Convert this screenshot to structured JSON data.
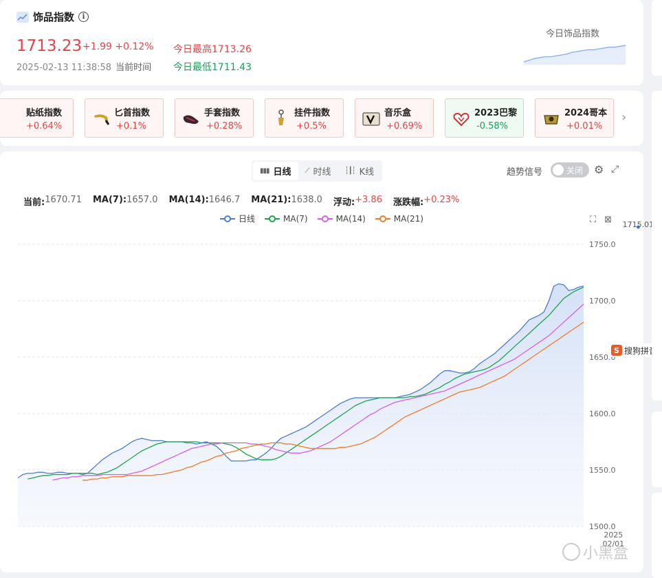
{
  "header": {
    "title": "饰品指数",
    "info_icon": "i",
    "price": "1713.23",
    "change": "+1.99",
    "change_pct": "+0.12%",
    "timestamp": "2025-02-13 11:38:58",
    "timestamp_label": "当前时间",
    "today_high": "今日最高1713.26",
    "today_low": "今日最低1711.43",
    "mini_chart_label": "今日饰品指数",
    "colors": {
      "up": "#e84343",
      "down": "#1aa05a"
    }
  },
  "categories": {
    "prev_icon": "chevron-left-icon",
    "next_icon": "chevron-right-icon",
    "items": [
      {
        "name": "贴纸指数",
        "pct": "+0.64%",
        "trend": "up",
        "icon": "sticker-icon"
      },
      {
        "name": "匕首指数",
        "pct": "+0.1%",
        "trend": "up",
        "icon": "knife-icon"
      },
      {
        "name": "手套指数",
        "pct": "+0.28%",
        "trend": "up",
        "icon": "glove-icon"
      },
      {
        "name": "挂件指数",
        "pct": "+0.5%",
        "trend": "up",
        "icon": "charm-icon"
      },
      {
        "name": "音乐盒",
        "pct": "+0.69%",
        "trend": "up",
        "icon": "music-kit-icon"
      },
      {
        "name": "2023巴黎",
        "pct": "-0.58%",
        "trend": "down",
        "icon": "paris-2023-icon"
      },
      {
        "name": "2024哥本",
        "pct": "+0.01%",
        "trend": "up",
        "icon": "copenhagen-2024-icon"
      }
    ]
  },
  "chart_panel": {
    "tabs": [
      {
        "label": "日线",
        "active": true,
        "icon": "bar-chart-icon"
      },
      {
        "label": "时线",
        "active": false,
        "icon": "line-chart-icon"
      },
      {
        "label": "K线",
        "active": false,
        "icon": "candlestick-icon"
      }
    ],
    "trend_signal_label": "趋势信号",
    "toggle_label": "关闭",
    "stats": {
      "current_label": "当前:",
      "current": "1670.71",
      "ma7_label": "MA(7):",
      "ma7": "1657.0",
      "ma14_label": "MA(14):",
      "ma14": "1646.7",
      "ma21_label": "MA(21):",
      "ma21": "1638.0",
      "float_label": "浮动:",
      "float": "+3.86",
      "pct_label": "涨跌幅:",
      "pct": "+0.23%"
    },
    "ime_text": "搜狗拼音输",
    "ime_logo": "S",
    "watermark": "小黑盒"
  },
  "chart_data": {
    "type": "line",
    "ylim": [
      1500,
      1750
    ],
    "yticks": [
      "1750.0",
      "1700.0",
      "1650.0",
      "1600.0",
      "1550.0",
      "1500.0"
    ],
    "x_tick_label": [
      "2025",
      "02/01"
    ],
    "x_tick_index": 120,
    "legend_position": "top-center",
    "grid": true,
    "peak_label": "1715.01",
    "peak_index": 125,
    "series": [
      {
        "name": "日线",
        "color": "#4a7cd4",
        "area": true,
        "values": [
          1543,
          1546,
          1547,
          1547,
          1548,
          1548,
          1547,
          1547,
          1548,
          1548,
          1547,
          1547,
          1547,
          1546,
          1547,
          1551,
          1555,
          1559,
          1562,
          1565,
          1567,
          1569,
          1572,
          1575,
          1577,
          1578,
          1577,
          1576,
          1576,
          1576,
          1575,
          1575,
          1575,
          1575,
          1574,
          1574,
          1573,
          1574,
          1575,
          1573,
          1571,
          1567,
          1562,
          1558,
          1558,
          1558,
          1558,
          1559,
          1559,
          1562,
          1565,
          1569,
          1574,
          1578,
          1580,
          1582,
          1584,
          1586,
          1588,
          1591,
          1594,
          1597,
          1600,
          1603,
          1606,
          1609,
          1611,
          1613,
          1614,
          1614,
          1614,
          1614,
          1614,
          1614,
          1614,
          1614,
          1614,
          1615,
          1616,
          1617,
          1619,
          1621,
          1624,
          1627,
          1631,
          1635,
          1638,
          1638,
          1637,
          1636,
          1636,
          1637,
          1640,
          1644,
          1647,
          1650,
          1653,
          1657,
          1661,
          1665,
          1669,
          1673,
          1678,
          1683,
          1685,
          1687,
          1690,
          1700,
          1713,
          1715,
          1714,
          1709,
          1710,
          1712,
          1713
        ]
      },
      {
        "name": "MA(7)",
        "color": "#1aa54a",
        "values": [
          1542,
          1543,
          1544,
          1545,
          1545,
          1546,
          1546,
          1546,
          1546,
          1547,
          1547,
          1547,
          1547,
          1547,
          1546,
          1547,
          1548,
          1550,
          1552,
          1555,
          1558,
          1561,
          1564,
          1567,
          1569,
          1571,
          1573,
          1574,
          1575,
          1575,
          1575,
          1575,
          1575,
          1575,
          1575,
          1574,
          1574,
          1574,
          1574,
          1574,
          1573,
          1572,
          1570,
          1567,
          1564,
          1562,
          1560,
          1559,
          1559,
          1559,
          1560,
          1562,
          1565,
          1568,
          1571,
          1574,
          1577,
          1580,
          1583,
          1586,
          1589,
          1592,
          1595,
          1598,
          1601,
          1604,
          1607,
          1609,
          1611,
          1612,
          1613,
          1614,
          1614,
          1614,
          1614,
          1614,
          1614,
          1615,
          1615,
          1616,
          1617,
          1619,
          1621,
          1623,
          1626,
          1628,
          1631,
          1633,
          1635,
          1636,
          1637,
          1638,
          1639,
          1641,
          1644,
          1647,
          1651,
          1655,
          1659,
          1663,
          1667,
          1671,
          1675,
          1679,
          1683,
          1687,
          1692,
          1697,
          1702,
          1705,
          1708,
          1710,
          1712
        ]
      },
      {
        "name": "MA(14)",
        "color": "#d65ee8",
        "values": [
          1541,
          1542,
          1543,
          1543,
          1544,
          1544,
          1545,
          1545,
          1545,
          1545,
          1546,
          1546,
          1546,
          1546,
          1546,
          1546,
          1547,
          1548,
          1549,
          1551,
          1553,
          1555,
          1557,
          1559,
          1561,
          1563,
          1565,
          1567,
          1569,
          1570,
          1571,
          1572,
          1573,
          1573,
          1574,
          1574,
          1574,
          1574,
          1574,
          1574,
          1573,
          1573,
          1572,
          1571,
          1570,
          1568,
          1567,
          1566,
          1565,
          1565,
          1565,
          1566,
          1567,
          1569,
          1571,
          1573,
          1575,
          1578,
          1581,
          1584,
          1587,
          1590,
          1593,
          1596,
          1599,
          1601,
          1604,
          1606,
          1608,
          1610,
          1611,
          1612,
          1613,
          1614,
          1615,
          1616,
          1617,
          1618,
          1619,
          1620,
          1622,
          1624,
          1626,
          1628,
          1630,
          1632,
          1634,
          1636,
          1638,
          1640,
          1642,
          1644,
          1646,
          1648,
          1651,
          1654,
          1657,
          1660,
          1663,
          1666,
          1669,
          1673,
          1677,
          1681,
          1685,
          1689,
          1693,
          1697
        ]
      },
      {
        "name": "MA(21)",
        "color": "#f07a2a",
        "values": [
          1541,
          1541,
          1542,
          1542,
          1543,
          1543,
          1544,
          1544,
          1544,
          1545,
          1545,
          1545,
          1545,
          1545,
          1545,
          1546,
          1546,
          1547,
          1548,
          1549,
          1550,
          1552,
          1553,
          1555,
          1557,
          1558,
          1560,
          1562,
          1563,
          1565,
          1566,
          1567,
          1569,
          1570,
          1571,
          1572,
          1573,
          1573,
          1574,
          1574,
          1574,
          1573,
          1573,
          1572,
          1571,
          1570,
          1569,
          1569,
          1569,
          1569,
          1569,
          1569,
          1570,
          1570,
          1571,
          1572,
          1573,
          1575,
          1577,
          1579,
          1582,
          1585,
          1588,
          1591,
          1594,
          1597,
          1599,
          1601,
          1603,
          1605,
          1607,
          1609,
          1611,
          1613,
          1615,
          1617,
          1619,
          1620,
          1621,
          1622,
          1623,
          1625,
          1627,
          1629,
          1631,
          1633,
          1636,
          1639,
          1642,
          1645,
          1648,
          1651,
          1654,
          1657,
          1660,
          1663,
          1666,
          1669,
          1672,
          1675,
          1678,
          1681
        ]
      }
    ]
  },
  "mini_chart": {
    "values": [
      1711.4,
      1711.6,
      1711.8,
      1711.9,
      1712.0,
      1712.0,
      1712.1,
      1712.2,
      1712.3,
      1712.5,
      1712.6,
      1712.7,
      1712.8,
      1712.8,
      1712.9,
      1713.0,
      1713.1,
      1713.1,
      1713.2,
      1713.3
    ]
  }
}
